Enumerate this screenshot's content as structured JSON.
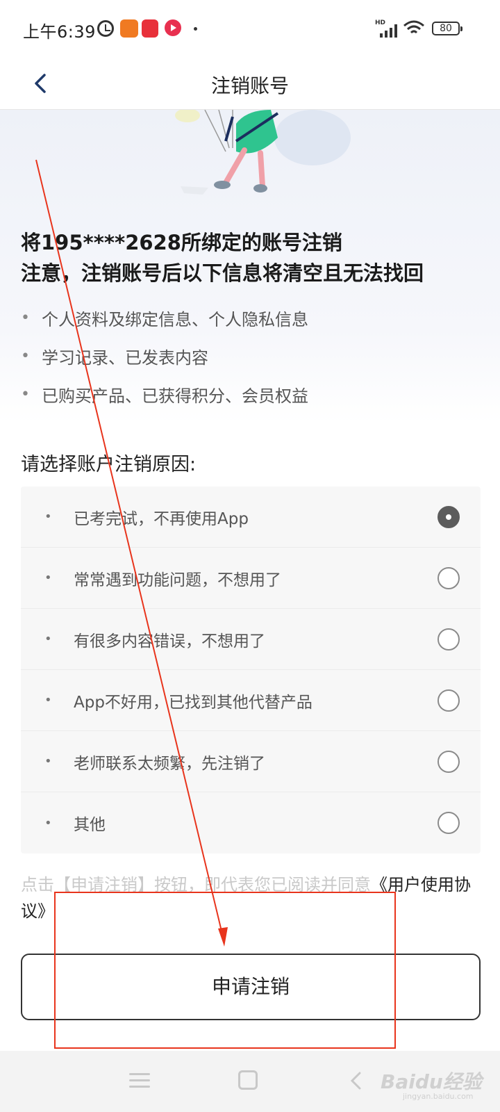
{
  "status_bar": {
    "time": "上午6:39",
    "network": "HD",
    "battery": "80"
  },
  "nav": {
    "title": "注销账号"
  },
  "warning": {
    "line1": "将195****2628所绑定的账号注销",
    "line2": "注意，注销账号后以下信息将清空且无法找回"
  },
  "info_items": [
    "个人资料及绑定信息、个人隐私信息",
    "学习记录、已发表内容",
    "已购买产品、已获得积分、会员权益"
  ],
  "reason_title": "请选择账户注销原因:",
  "reasons": [
    {
      "label": "已考完试，不再使用App",
      "selected": true
    },
    {
      "label": "常常遇到功能问题，不想用了",
      "selected": false
    },
    {
      "label": "有很多内容错误，不想用了",
      "selected": false
    },
    {
      "label": "App不好用，已找到其他代替产品",
      "selected": false
    },
    {
      "label": "老师联系太频繁，先注销了",
      "selected": false
    },
    {
      "label": "其他",
      "selected": false
    }
  ],
  "agreement": {
    "text": "点击【申请注销】按钮，即代表您已阅读并同意",
    "link": "《用户使用协议》"
  },
  "submit_label": "申请注销",
  "watermark": {
    "brand": "Baidu经验",
    "url": "jingyan.baidu.com"
  },
  "colors": {
    "annotation": "#e8341c",
    "hero_bg": "#eef1f8"
  }
}
